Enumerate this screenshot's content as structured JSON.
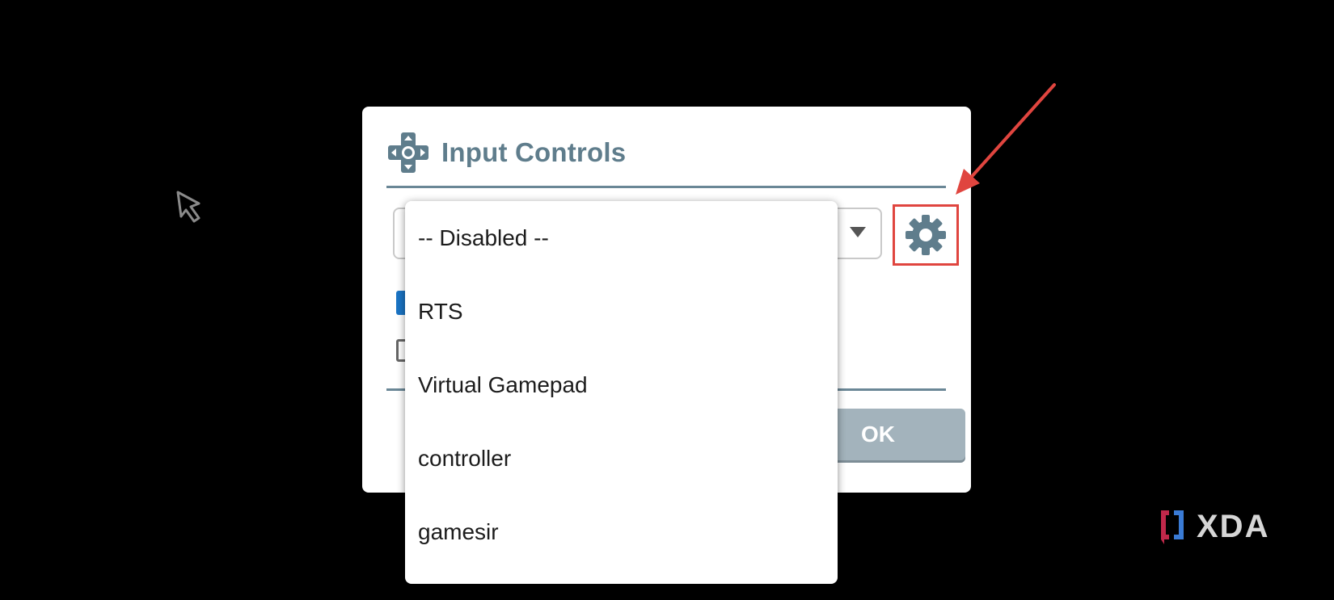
{
  "dialog": {
    "title": "Input Controls",
    "title_icon": "dpad-icon",
    "settings_icon": "gear-icon",
    "ok_label": "OK",
    "checkbox_1_checked": true,
    "checkbox_2_checked": false
  },
  "dropdown": {
    "options": [
      {
        "label": "-- Disabled --"
      },
      {
        "label": "RTS"
      },
      {
        "label": "Virtual Gamepad"
      },
      {
        "label": "controller"
      },
      {
        "label": "gamesir"
      }
    ]
  },
  "watermark": {
    "text": "XDA"
  },
  "colors": {
    "accent": "#5f7d8c",
    "annotation": "#e0453f",
    "checkbox": "#1a74c4",
    "ok_button": "#a3b3bc"
  }
}
